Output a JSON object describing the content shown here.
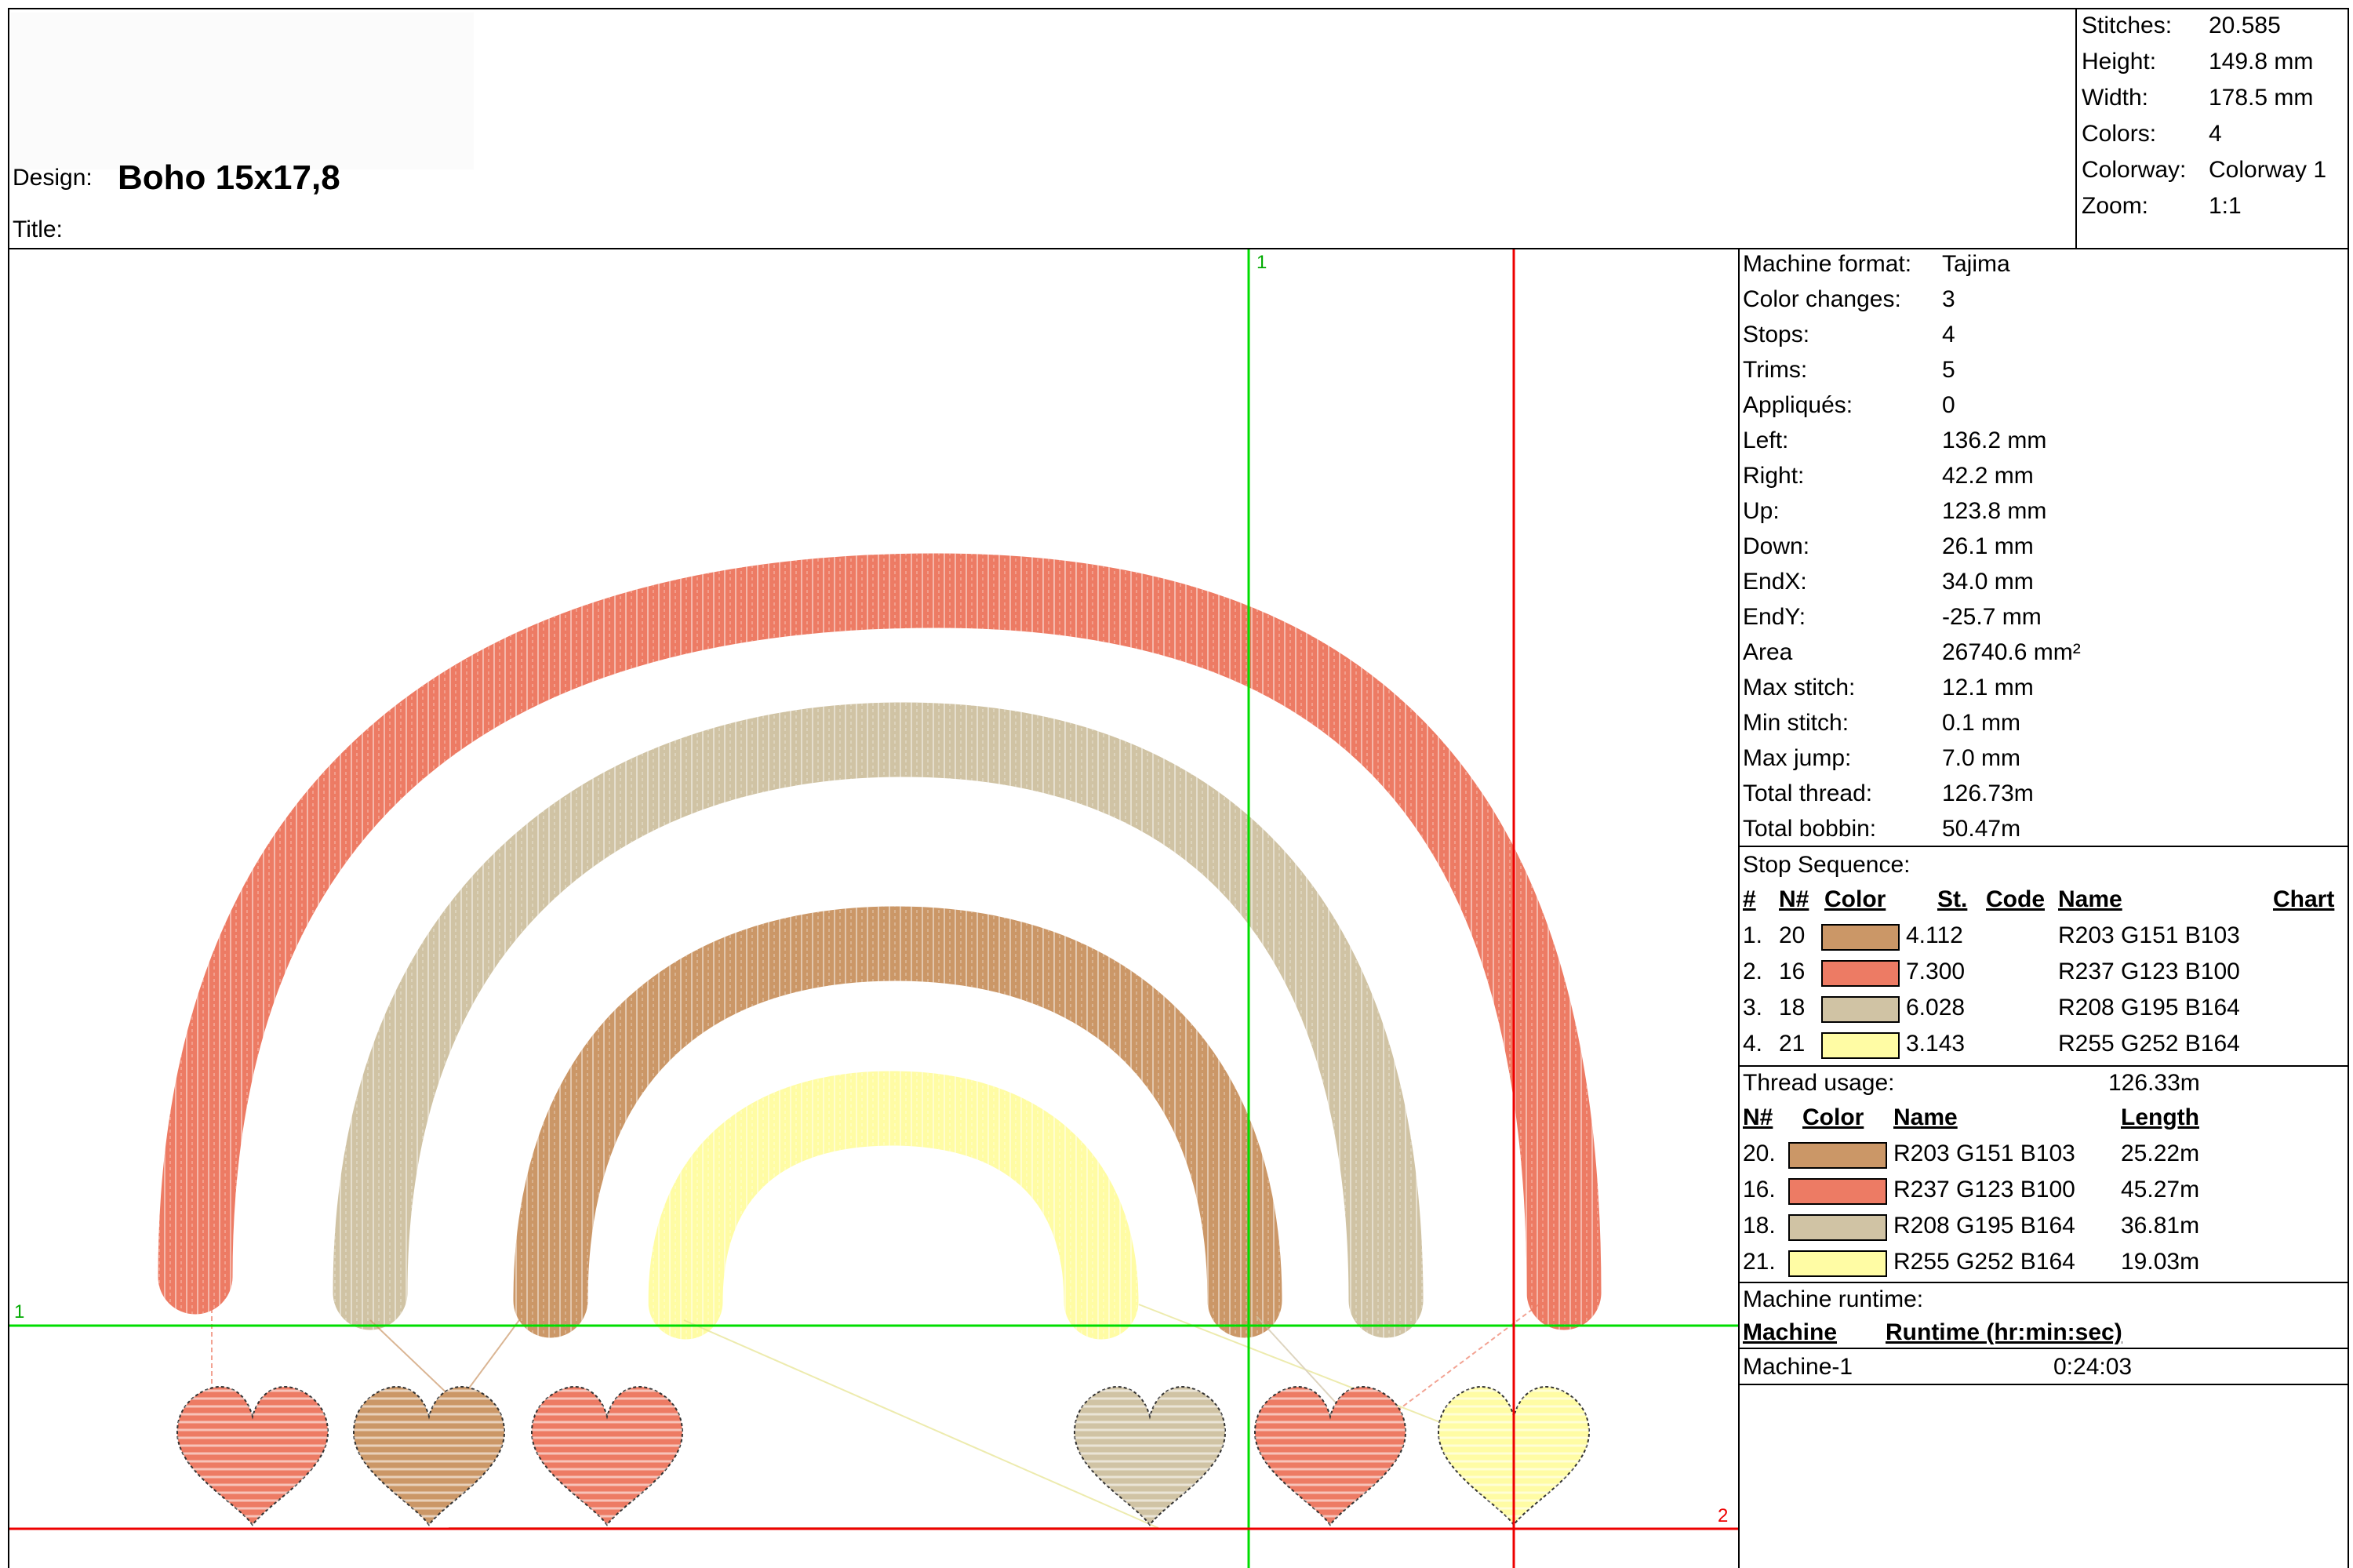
{
  "header": {
    "design_label": "Design:",
    "design_value": "Boho 15x17,8",
    "title_label": "Title:"
  },
  "summary": [
    {
      "label": "Stitches:",
      "value": "20.585"
    },
    {
      "label": "Height:",
      "value": "149.8 mm"
    },
    {
      "label": "Width:",
      "value": "178.5 mm"
    },
    {
      "label": "Colors:",
      "value": "4"
    },
    {
      "label": "Colorway:",
      "value": "Colorway 1"
    },
    {
      "label": "Zoom:",
      "value": "1:1"
    }
  ],
  "machine_info": [
    {
      "label": "Machine format:",
      "value": "Tajima"
    },
    {
      "label": "Color changes:",
      "value": "3"
    },
    {
      "label": "Stops:",
      "value": "4"
    },
    {
      "label": "Trims:",
      "value": "5"
    },
    {
      "label": "Appliqués:",
      "value": "0"
    },
    {
      "label": "Left:",
      "value": "136.2 mm"
    },
    {
      "label": "Right:",
      "value": "42.2 mm"
    },
    {
      "label": "Up:",
      "value": "123.8 mm"
    },
    {
      "label": "Down:",
      "value": "26.1 mm"
    },
    {
      "label": "EndX:",
      "value": "34.0 mm"
    },
    {
      "label": "EndY:",
      "value": "-25.7 mm"
    },
    {
      "label": "Area",
      "value": "26740.6 mm²"
    },
    {
      "label": "Max stitch:",
      "value": "12.1 mm"
    },
    {
      "label": "Min stitch:",
      "value": "0.1 mm"
    },
    {
      "label": "Max jump:",
      "value": "7.0 mm"
    },
    {
      "label": "Total thread:",
      "value": "126.73m"
    },
    {
      "label": "Total bobbin:",
      "value": "50.47m"
    }
  ],
  "stop_sequence": {
    "title": "Stop Sequence:",
    "headers": {
      "num": "#",
      "n": "N#",
      "color": "Color",
      "st": "St.",
      "code": "Code",
      "name": "Name",
      "chart": "Chart"
    },
    "rows": [
      {
        "num": "1.",
        "n": "20",
        "color": "#CB9767",
        "st": "4.112",
        "name": "R203 G151 B103"
      },
      {
        "num": "2.",
        "n": "16",
        "color": "#ED7B64",
        "st": "7.300",
        "name": "R237 G123 B100"
      },
      {
        "num": "3.",
        "n": "18",
        "color": "#D0C3A4",
        "st": "6.028",
        "name": "R208 G195 B164"
      },
      {
        "num": "4.",
        "n": "21",
        "color": "#FFFCA4",
        "st": "3.143",
        "name": "R255 G252 B164"
      }
    ]
  },
  "thread_usage": {
    "title": "Thread usage:",
    "total": "126.33m",
    "headers": {
      "n": "N#",
      "color": "Color",
      "name": "Name",
      "length": "Length"
    },
    "rows": [
      {
        "n": "20.",
        "color": "#CB9767",
        "name": "R203 G151 B103",
        "length": "25.22m"
      },
      {
        "n": "16.",
        "color": "#ED7B64",
        "name": "R237 G123 B100",
        "length": "45.27m"
      },
      {
        "n": "18.",
        "color": "#D0C3A4",
        "name": "R208 G195 B164",
        "length": "36.81m"
      },
      {
        "n": "21.",
        "color": "#FFFCA4",
        "name": "R255 G252 B164",
        "length": "19.03m"
      }
    ]
  },
  "runtime": {
    "title": "Machine runtime:",
    "headers": {
      "machine": "Machine",
      "runtime": "Runtime (hr:min:sec)"
    },
    "rows": [
      {
        "machine": "Machine-1",
        "runtime": "0:24:03"
      }
    ]
  },
  "guides": {
    "green_v_label": "1",
    "green_h_label": "1",
    "red_h_label": "2"
  },
  "colors": {
    "terracotta": "#ED7B64",
    "beige": "#D0C3A4",
    "caramel": "#CB9767",
    "lemon": "#FFFCA4",
    "guide_green": "#00DD00",
    "guide_red": "#EE0000"
  }
}
